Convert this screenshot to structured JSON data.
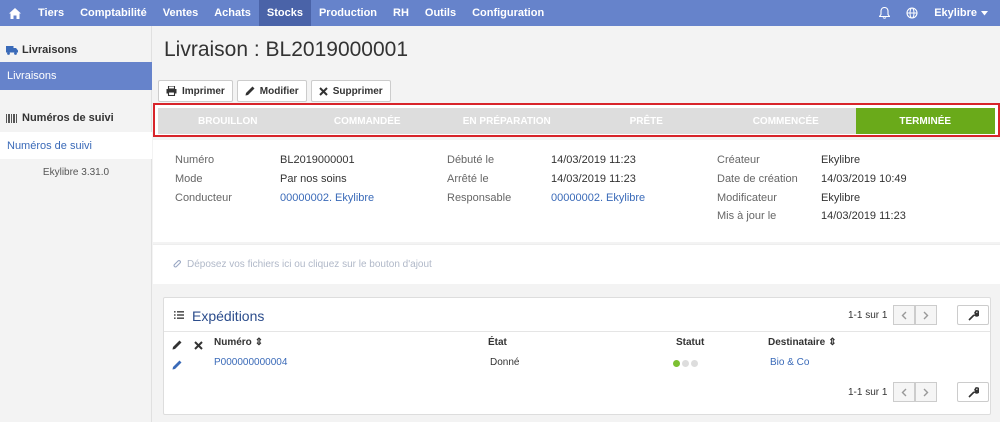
{
  "nav": {
    "items": [
      "Tiers",
      "Comptabilité",
      "Ventes",
      "Achats",
      "Stocks",
      "Production",
      "RH",
      "Outils",
      "Configuration"
    ],
    "active": "Stocks",
    "user": "Ekylibre"
  },
  "sidebar": {
    "section1": "Livraisons",
    "link1": "Livraisons",
    "section2": "Numéros de suivi",
    "link2": "Numéros de suivi",
    "version": "Ekylibre 3.31.0"
  },
  "page": {
    "title": "Livraison : BL2019000001"
  },
  "toolbar": {
    "print": "Imprimer",
    "edit": "Modifier",
    "delete": "Supprimer"
  },
  "steps": [
    "BROUILLON",
    "COMMANDÉE",
    "EN PRÉPARATION",
    "PRÊTE",
    "COMMENCÉE",
    "TERMINÉE"
  ],
  "current_step": "TERMINÉE",
  "info": {
    "numero_label": "Numéro",
    "numero": "BL2019000001",
    "mode_label": "Mode",
    "mode": "Par nos soins",
    "conducteur_label": "Conducteur",
    "conducteur": "00000002. Ekylibre",
    "debute_label": "Débuté le",
    "debute": "14/03/2019 11:23",
    "arrete_label": "Arrêté le",
    "arrete": "14/03/2019 11:23",
    "responsable_label": "Responsable",
    "responsable": "00000002. Ekylibre",
    "createur_label": "Créateur",
    "createur": "Ekylibre",
    "date_creation_label": "Date de création",
    "date_creation": "14/03/2019 10:49",
    "modificateur_label": "Modificateur",
    "modificateur": "Ekylibre",
    "maj_label": "Mis à jour le",
    "maj": "14/03/2019 11:23"
  },
  "dropzone": "Déposez vos fichiers ici ou cliquez sur le bouton d'ajout",
  "expeditions": {
    "title": "Expéditions",
    "pager": "1-1 sur 1",
    "columns": [
      "Numéro",
      "État",
      "Statut",
      "Destinataire"
    ],
    "rows": [
      {
        "numero": "P000000000004",
        "etat": "Donné",
        "statut": "green",
        "destinataire": "Bio & Co"
      }
    ]
  },
  "colors": {
    "nav": "#6683cb",
    "done": "#6aaa1a",
    "highlight": "#d8242a",
    "link": "#3a6ab8"
  }
}
